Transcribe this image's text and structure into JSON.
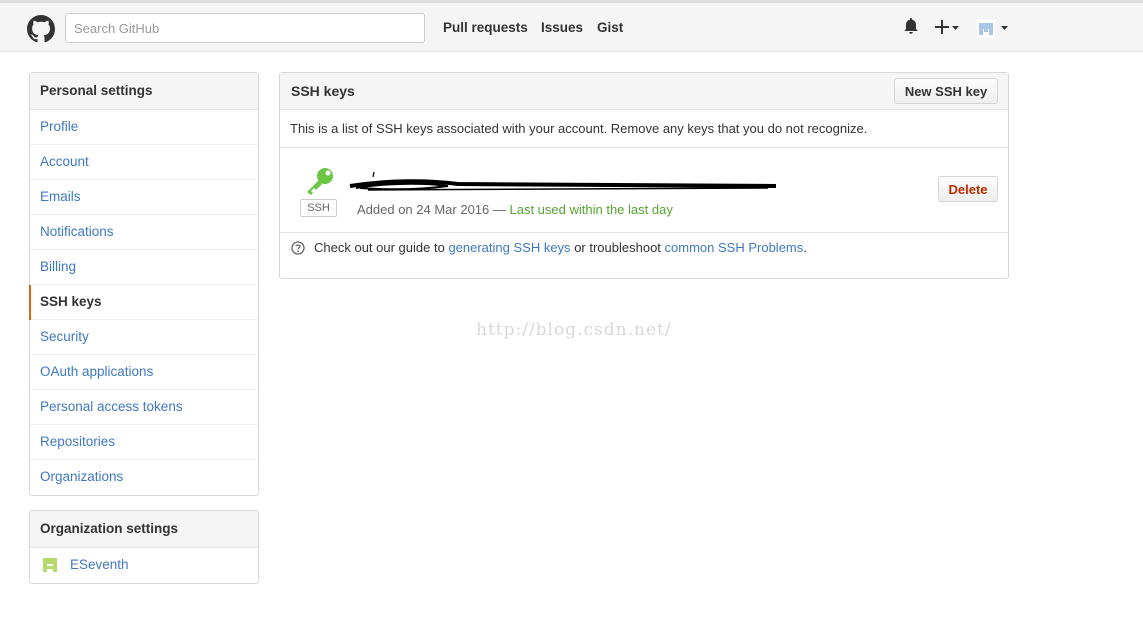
{
  "header": {
    "search_placeholder": "Search GitHub",
    "nav": [
      "Pull requests",
      "Issues",
      "Gist"
    ]
  },
  "sidebar": {
    "personal_title": "Personal settings",
    "items": [
      "Profile",
      "Account",
      "Emails",
      "Notifications",
      "Billing",
      "SSH keys",
      "Security",
      "OAuth applications",
      "Personal access tokens",
      "Repositories",
      "Organizations"
    ],
    "selected": "SSH keys",
    "org_title": "Organization settings",
    "org_name": "ESeventh"
  },
  "main": {
    "title": "SSH keys",
    "new_button": "New SSH key",
    "intro": "This is a list of SSH keys associated with your account. Remove any keys that you do not recognize.",
    "key": {
      "type_label": "SSH",
      "added_prefix": "Added on 24 Mar 2016 — ",
      "last_used": "Last used within the last day",
      "delete_button": "Delete"
    },
    "guide": {
      "text1": "Check out our guide to ",
      "link1": "generating SSH keys",
      "text2": " or troubleshoot ",
      "link2": "common SSH Problems",
      "text3": "."
    }
  },
  "watermark": "http://blog.csdn.net/",
  "colors": {
    "link": "#4078c0",
    "key_green": "#6cc644",
    "delete_red": "#bd2c00",
    "selected_accent": "#d26911"
  }
}
